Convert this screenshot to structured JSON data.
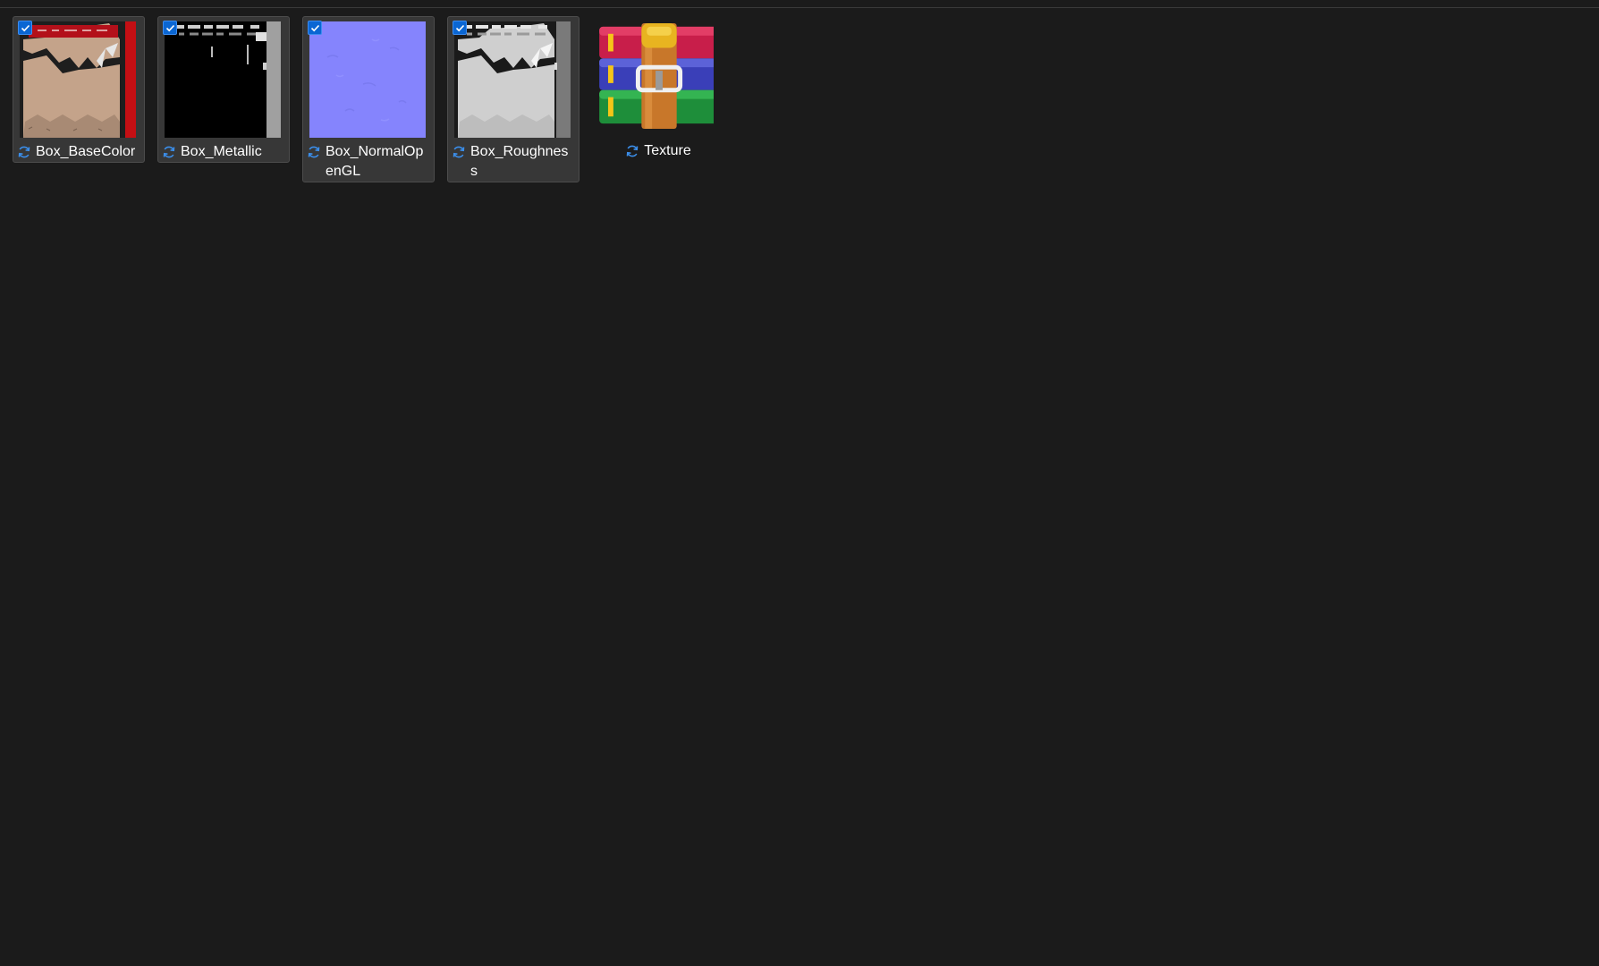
{
  "files": [
    {
      "name": "Box_BaseColor",
      "selected": true,
      "thumb": "basecolor-thumbnail",
      "status_icon": "sync-icon"
    },
    {
      "name": "Box_Metallic",
      "selected": true,
      "thumb": "metallic-thumbnail",
      "status_icon": "sync-icon"
    },
    {
      "name": "Box_NormalOpenGL",
      "selected": true,
      "thumb": "normal-thumbnail",
      "status_icon": "sync-icon"
    },
    {
      "name": "Box_Roughness",
      "selected": true,
      "thumb": "roughness-thumbnail",
      "status_icon": "sync-icon"
    },
    {
      "name": "Texture",
      "selected": false,
      "thumb": "winrar-archive-icon",
      "status_icon": "sync-icon"
    }
  ],
  "colors": {
    "background": "#1b1b1b",
    "selection": "#373737",
    "accent": "#0a66d3",
    "sync": "#3b8eea"
  }
}
